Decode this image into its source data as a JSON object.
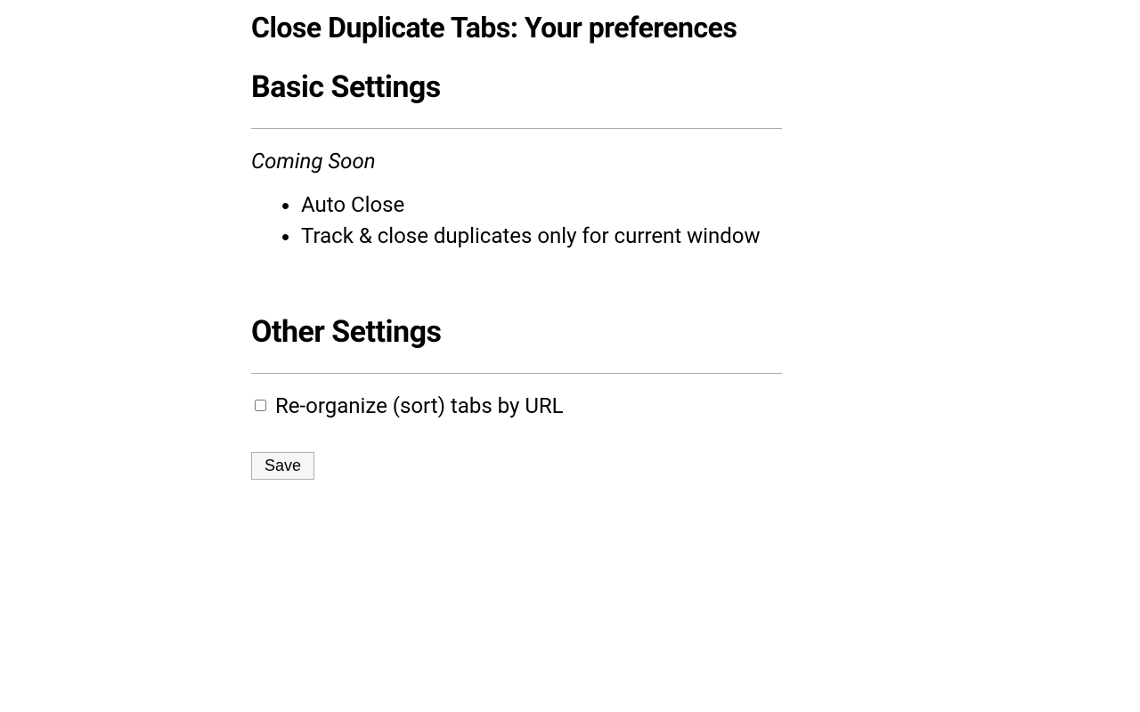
{
  "page": {
    "title": "Close Duplicate Tabs: Your preferences"
  },
  "basic": {
    "heading": "Basic Settings",
    "coming_soon_label": "Coming Soon",
    "features": [
      "Auto Close",
      "Track & close duplicates only for current window"
    ]
  },
  "other": {
    "heading": "Other Settings",
    "reorganize_label": "Re-organize (sort) tabs by URL",
    "reorganize_checked": false
  },
  "actions": {
    "save_label": "Save"
  }
}
